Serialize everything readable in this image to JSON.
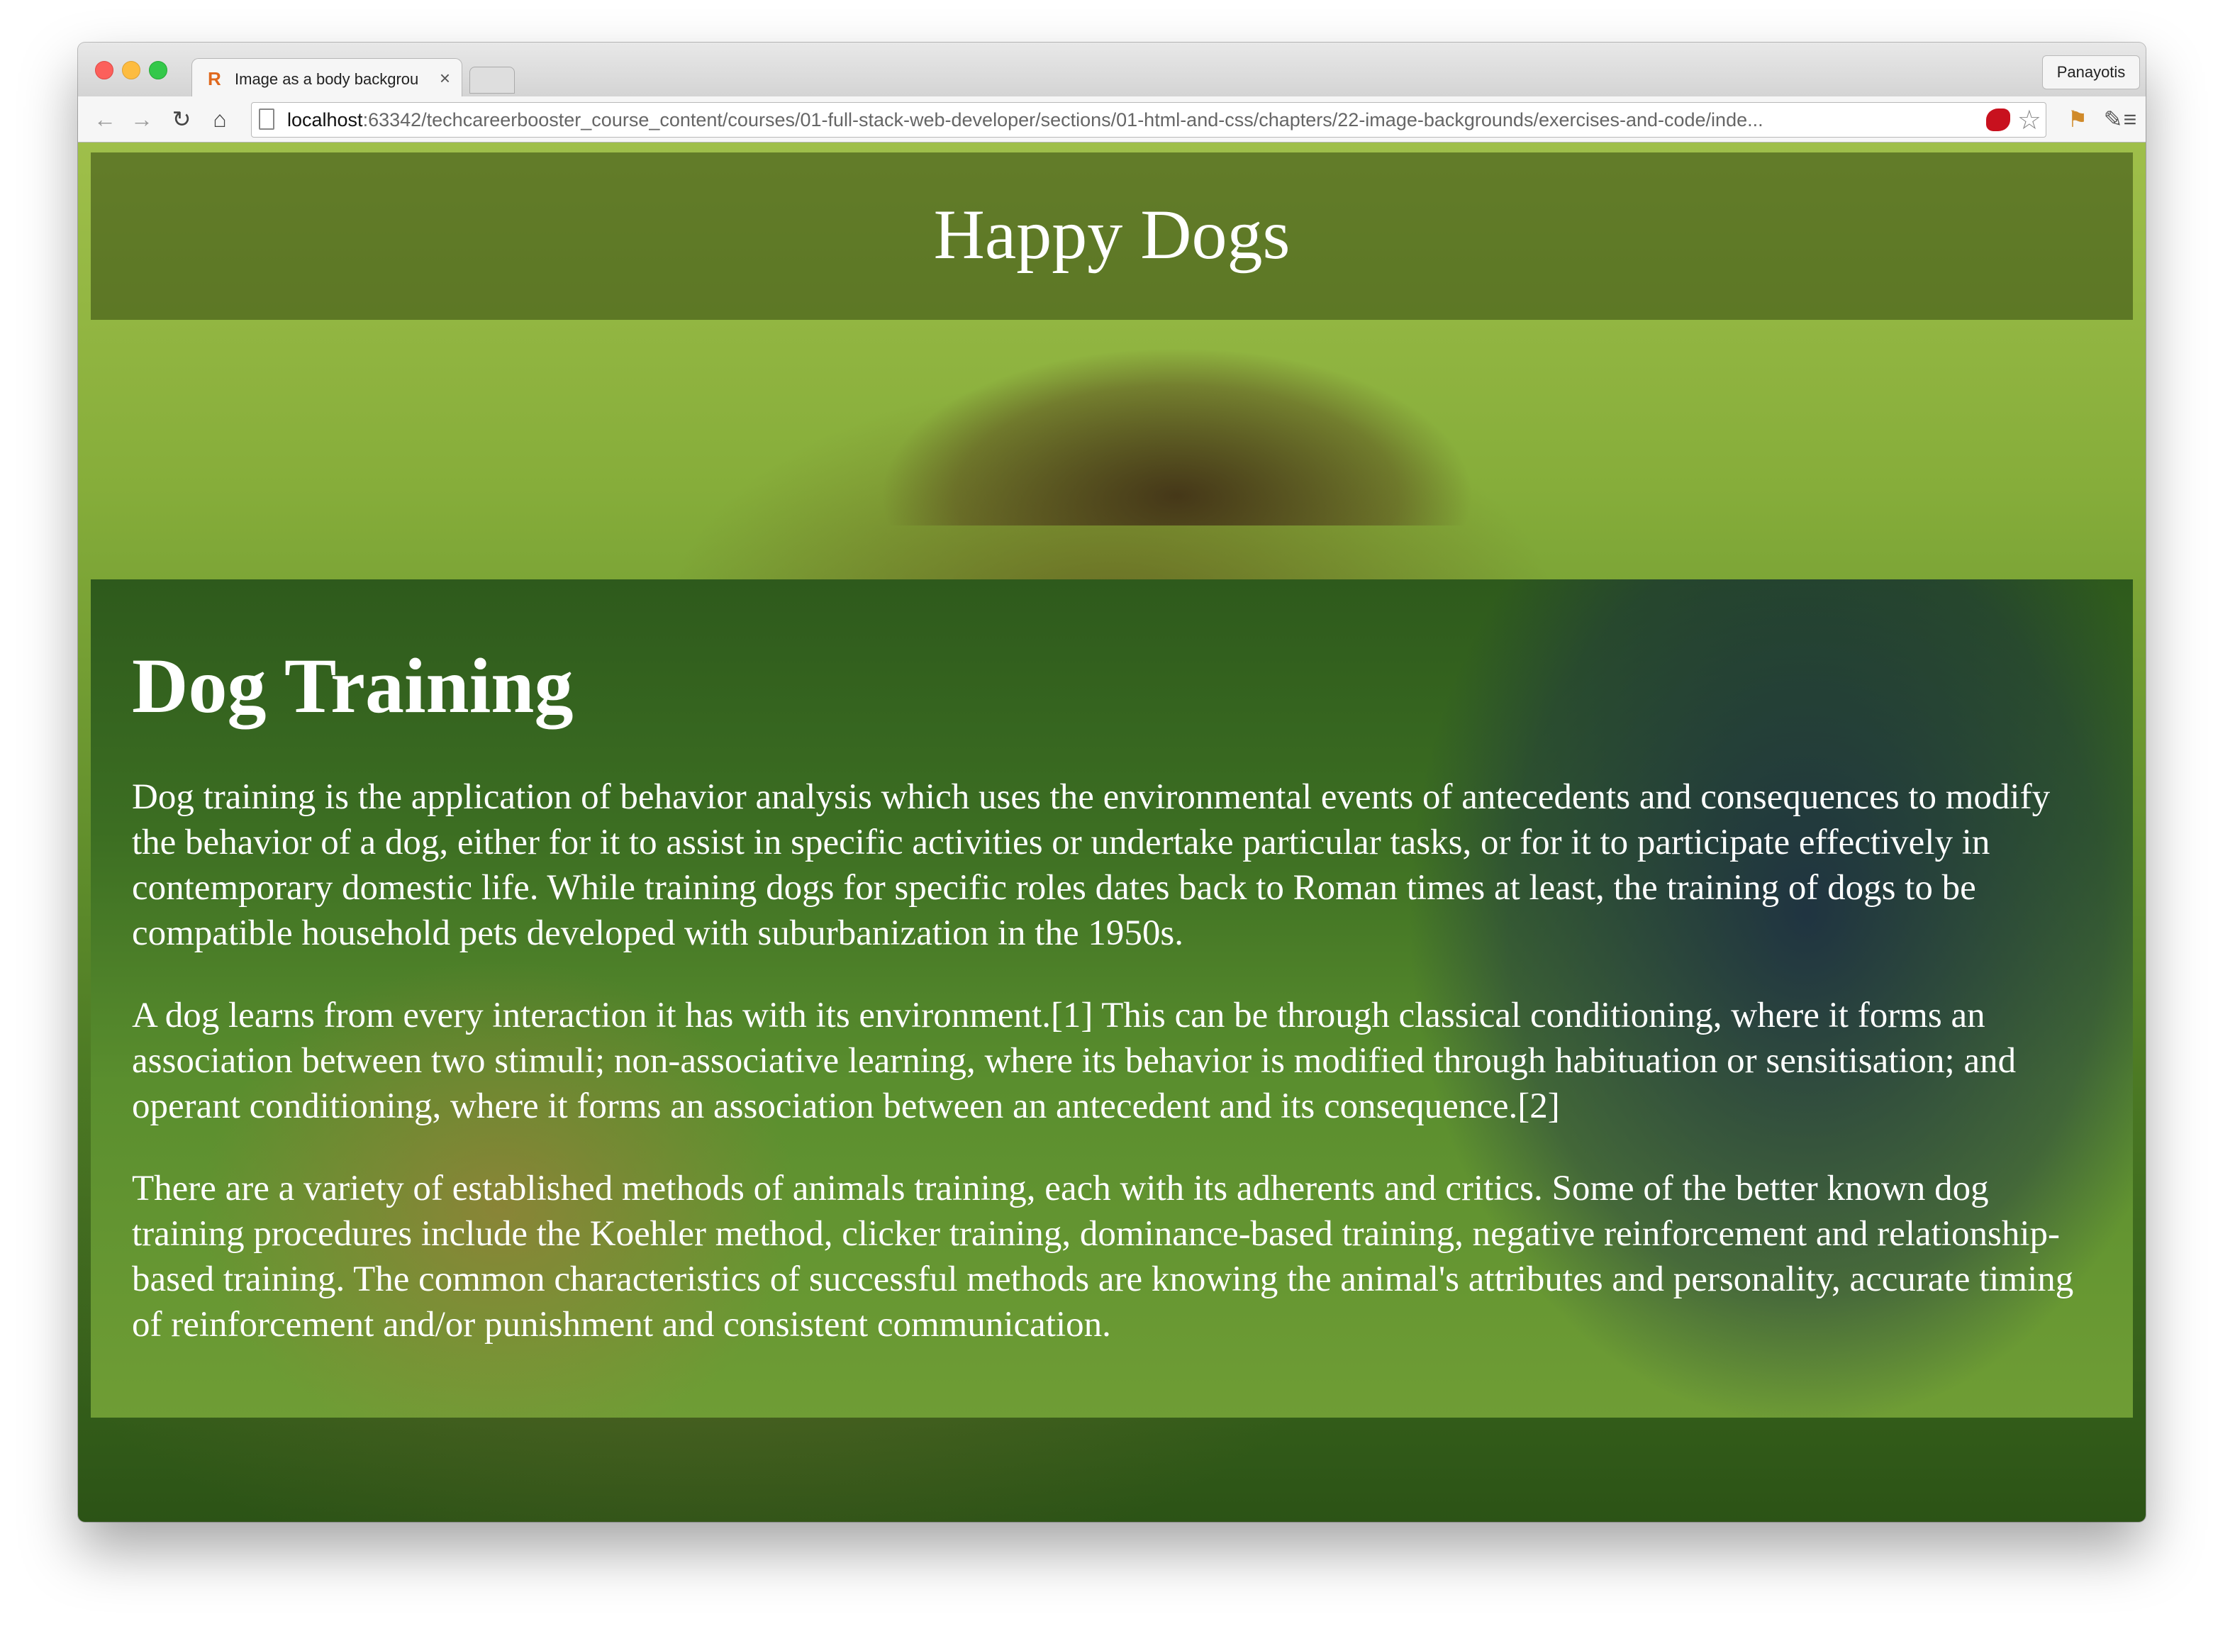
{
  "browser": {
    "tab_title": "Image as a body backgrou",
    "tab_favicon": "R",
    "tab_close": "×",
    "profile_name": "Panayotis",
    "url_host": "localhost",
    "url_rest": ":63342/techcareerbooster_course_content/courses/01-full-stack-web-developer/sections/01-html-and-css/chapters/22-image-backgrounds/exercises-and-code/inde...",
    "icons": {
      "back": "arrow-left-icon",
      "forward": "arrow-right-icon",
      "reload": "reload-icon",
      "home": "home-icon",
      "bookmark": "star-icon",
      "menu": "hamburger-menu-icon"
    }
  },
  "page": {
    "site_title": "Happy Dogs",
    "heading": "Dog Training",
    "paragraphs": [
      "Dog training is the application of behavior analysis which uses the environmental events of antecedents and consequences to modify the behavior of a dog, either for it to assist in specific activities or undertake particular tasks, or for it to participate effectively in contemporary domestic life. While training dogs for specific roles dates back to Roman times at least, the training of dogs to be compatible household pets developed with suburbanization in the 1950s.",
      "A dog learns from every interaction it has with its environment.[1] This can be through classical conditioning, where it forms an association between two stimuli; non-associative learning, where its behavior is modified through habituation or sensitisation; and operant conditioning, where it forms an association between an antecedent and its consequence.[2]",
      "There are a variety of established methods of animals training, each with its adherents and critics. Some of the better known dog training procedures include the Koehler method, clicker training, dominance-based training, negative reinforcement and relationship-based training. The common characteristics of successful methods are knowing the animal's attributes and personality, accurate timing of reinforcement and/or punishment and consistent communication."
    ]
  }
}
